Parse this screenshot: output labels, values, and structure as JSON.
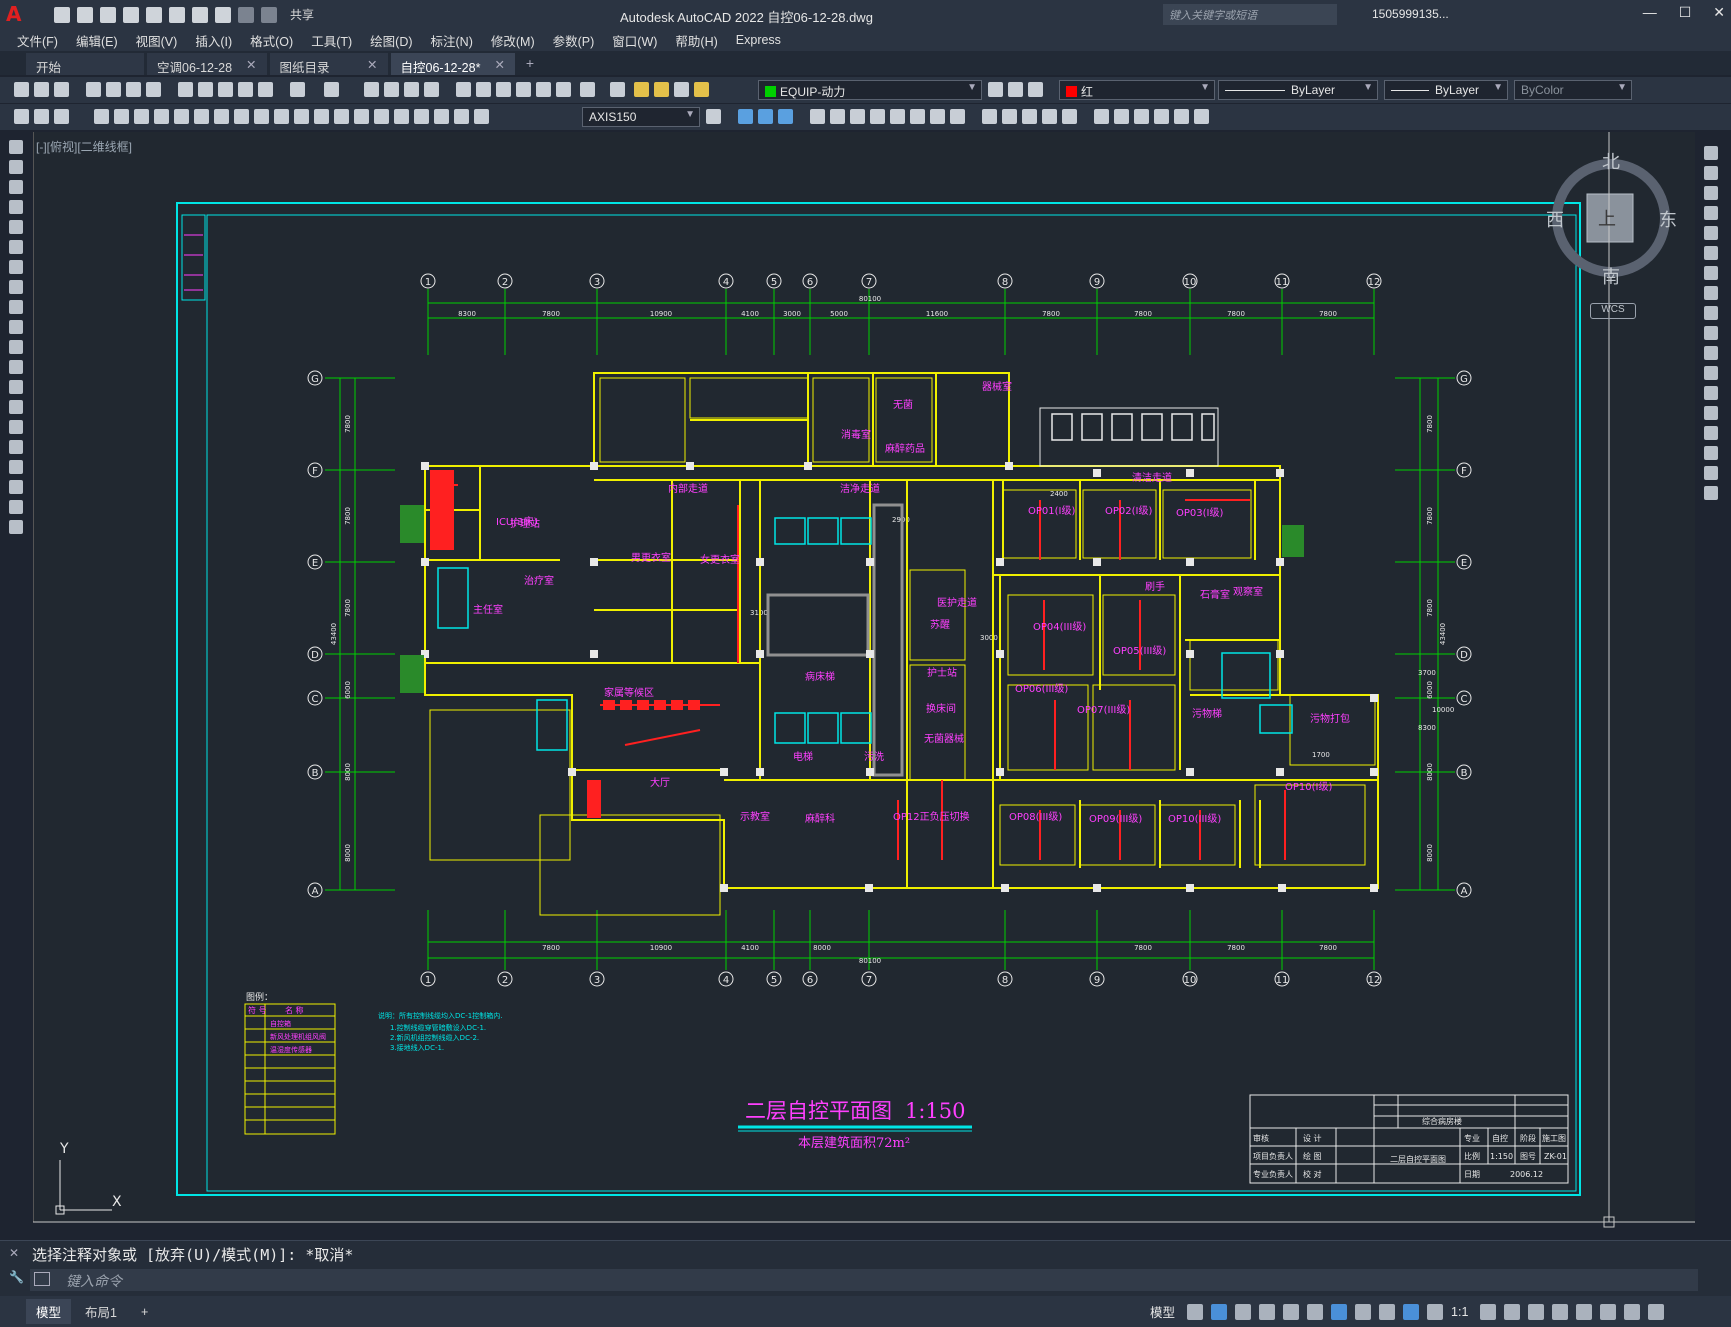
{
  "titlebar": {
    "app_title": "Autodesk AutoCAD 2022    自控06-12-28.dwg",
    "share_label": "共享",
    "search_placeholder": "键入关键字或短语",
    "user": "1505999135...",
    "logo": "A"
  },
  "menu": [
    "文件(F)",
    "编辑(E)",
    "视图(V)",
    "插入(I)",
    "格式(O)",
    "工具(T)",
    "绘图(D)",
    "标注(N)",
    "修改(M)",
    "参数(P)",
    "窗口(W)",
    "帮助(H)",
    "Express"
  ],
  "tabs": [
    {
      "label": "开始",
      "closable": false
    },
    {
      "label": "空调06-12-28",
      "closable": true
    },
    {
      "label": "图纸目录",
      "closable": true
    },
    {
      "label": "自控06-12-28*",
      "closable": true,
      "active": true
    }
  ],
  "toolbar": {
    "layer": "EQUIP-动力",
    "color": "红",
    "linetype": "ByLayer",
    "lineweight": "ByLayer",
    "plotstyle": "ByColor",
    "dimstyle": "AXIS150"
  },
  "viewport": {
    "label": "[-][俯视][二维线框]",
    "viewcube": {
      "north": "北",
      "south": "南",
      "east": "东",
      "west": "西",
      "top": "上",
      "wcs": "WCS"
    }
  },
  "drawing": {
    "colors": {
      "frame": "#00e5e5",
      "wall": "#f0f000",
      "axis": "#00d000",
      "room": "#ff40ff",
      "pipe": "#ff2020",
      "white": "#e8e8e8"
    },
    "axes_top": [
      "1",
      "2",
      "3",
      "4",
      "5",
      "6",
      "7",
      "8",
      "9",
      "10",
      "11",
      "12"
    ],
    "axes_side": [
      "G",
      "F",
      "E",
      "D",
      "C",
      "B",
      "A"
    ],
    "dims_top": [
      "8300",
      "7800",
      "10900",
      "4100",
      "3000",
      "5000",
      "11600",
      "7800",
      "7800",
      "7800",
      "7800"
    ],
    "dims_bottom": [
      "7800",
      "10900",
      "4100",
      "8000",
      "7800",
      "7800",
      "7800"
    ],
    "overall_dim": "80100",
    "side_dims_left": [
      "7800",
      "7800",
      "7800",
      "6000",
      "8000",
      "8000"
    ],
    "side_total": "43400",
    "rooms": [
      {
        "name": "无菌",
        "color": "room"
      },
      {
        "name": "消毒室",
        "color": "room"
      },
      {
        "name": "麻醉药品",
        "color": "room"
      },
      {
        "name": "器械室",
        "color": "room"
      },
      {
        "name": "内部走道",
        "color": "room"
      },
      {
        "name": "清洁走道",
        "color": "room"
      },
      {
        "name": "洁净走道",
        "color": "room"
      },
      {
        "name": "医护走道",
        "color": "room"
      },
      {
        "name": "OP01(I级)",
        "color": "room"
      },
      {
        "name": "OP02(I级)",
        "color": "room"
      },
      {
        "name": "OP03(I级)",
        "color": "room"
      },
      {
        "name": "OP04(III级)",
        "color": "room"
      },
      {
        "name": "OP05(III级)",
        "color": "room"
      },
      {
        "name": "OP06(III级)",
        "color": "room"
      },
      {
        "name": "OP07(III级)",
        "color": "room"
      },
      {
        "name": "OP08(III级)",
        "color": "room"
      },
      {
        "name": "OP09(III级)",
        "color": "room"
      },
      {
        "name": "OP10(III级)",
        "color": "room"
      },
      {
        "name": "OP10(I级)",
        "color": "room"
      },
      {
        "name": "OP12正负压切换",
        "color": "room"
      },
      {
        "name": "护士站",
        "color": "room"
      },
      {
        "name": "换床间",
        "color": "room"
      },
      {
        "name": "苏醒",
        "color": "room"
      },
      {
        "name": "刷手",
        "color": "room"
      },
      {
        "name": "石膏室",
        "color": "room"
      },
      {
        "name": "观察室",
        "color": "room"
      },
      {
        "name": "污物梯",
        "color": "room"
      },
      {
        "name": "污物打包",
        "color": "room"
      },
      {
        "name": "家属等候区",
        "color": "room"
      },
      {
        "name": "大厅",
        "color": "room"
      },
      {
        "name": "示教室",
        "color": "room"
      },
      {
        "name": "麻醉科",
        "color": "room"
      },
      {
        "name": "主任室",
        "color": "room"
      },
      {
        "name": "治疗室",
        "color": "room"
      },
      {
        "name": "男更衣室",
        "color": "room"
      },
      {
        "name": "女更衣室",
        "color": "room"
      },
      {
        "name": "ICU(3床)",
        "color": "room"
      },
      {
        "name": "无菌器械",
        "color": "room"
      },
      {
        "name": "电梯",
        "color": "room"
      },
      {
        "name": "病床梯",
        "color": "room"
      },
      {
        "name": "污洗",
        "color": "room"
      },
      {
        "name": "护理站",
        "color": "room"
      }
    ],
    "dim_small": [
      "2900",
      "3100",
      "3000",
      "3700",
      "8300",
      "10000",
      "1700",
      "2400"
    ],
    "legend_title": "图例：",
    "legend_header": [
      "符 号",
      "名 称"
    ],
    "legend_rows": [
      "自控箱",
      "新风处理机组风阀",
      "温湿度传感器"
    ],
    "notes": [
      "说明：所有控制线缆均入DC-1控制箱内.",
      "1.控制线缆穿管暗敷设入DC-1.",
      "2.新风机组控制线缆入DC-2.",
      "3.接地线入DC-1."
    ],
    "plan_title": "二层自控平面图",
    "plan_scale": "1:150",
    "plan_subtitle": "本层建筑面积72m²",
    "titleblock": {
      "project": "综合病房楼",
      "drawing_name": "二层自控平面图",
      "role_rows": [
        "审核",
        "项目负责人",
        "专业负责人"
      ],
      "role_rows2": [
        "设 计",
        "绘 图",
        "校 对"
      ],
      "discipline_label": "专业",
      "discipline": "自控",
      "stage_label": "阶段",
      "stage": "施工图",
      "scale_label": "比例",
      "scale": "1:150",
      "sheet_label": "图号",
      "sheet": "ZK-01",
      "date_label": "日期",
      "date": "2006.12"
    },
    "axis_x": "X",
    "axis_y": "Y"
  },
  "command": {
    "history": "选择注释对象或 [放弃(U)/模式(M)]: *取消*",
    "input_placeholder": "键入命令"
  },
  "status": {
    "tabs": [
      "模型",
      "布局1"
    ],
    "model_label": "模型",
    "scale": "1:1"
  }
}
